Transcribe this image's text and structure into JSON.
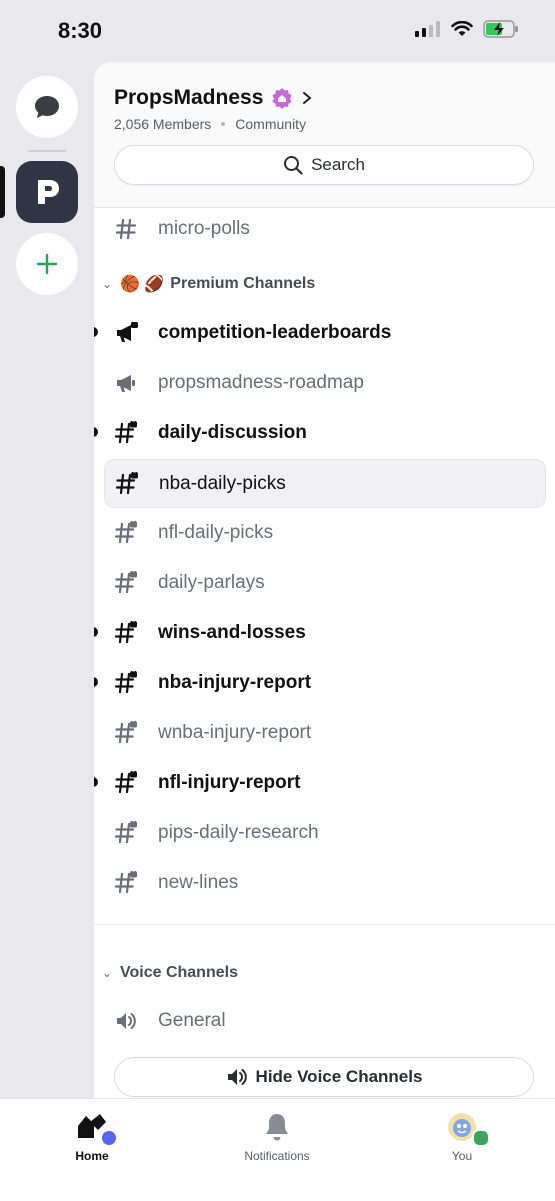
{
  "status": {
    "time": "8:30"
  },
  "server": {
    "name": "PropsMadness",
    "members": "2,056 Members",
    "type": "Community"
  },
  "search": {
    "label": "Search"
  },
  "top_channel": {
    "name": "micro-polls"
  },
  "premium_category": {
    "emoji": "🏀 🏈",
    "label": "Premium Channels"
  },
  "channels": [
    {
      "name": "competition-leaderboards",
      "icon": "megaphone-locked-icon",
      "unread": true
    },
    {
      "name": "propsmadness-roadmap",
      "icon": "megaphone-icon",
      "unread": false
    },
    {
      "name": "daily-discussion",
      "icon": "hash-locked-icon",
      "unread": true
    },
    {
      "name": "nba-daily-picks",
      "icon": "hash-locked-icon",
      "unread": false,
      "selected": true
    },
    {
      "name": "nfl-daily-picks",
      "icon": "hash-locked-icon",
      "unread": false
    },
    {
      "name": "daily-parlays",
      "icon": "hash-locked-icon",
      "unread": false
    },
    {
      "name": "wins-and-losses",
      "icon": "hash-locked-icon",
      "unread": true
    },
    {
      "name": "nba-injury-report",
      "icon": "hash-locked-icon",
      "unread": true
    },
    {
      "name": "wnba-injury-report",
      "icon": "hash-locked-icon",
      "unread": false
    },
    {
      "name": "nfl-injury-report",
      "icon": "hash-locked-icon",
      "unread": true
    },
    {
      "name": "pips-daily-research",
      "icon": "hash-locked-icon",
      "unread": false
    },
    {
      "name": "new-lines",
      "icon": "hash-locked-icon",
      "unread": false
    }
  ],
  "voice_category": {
    "label": "Voice Channels"
  },
  "voice_channels": [
    {
      "name": "General",
      "icon": "speaker-icon"
    }
  ],
  "hide_voice": {
    "label": "Hide Voice Channels"
  },
  "tabs": [
    {
      "label": "Home",
      "icon": "home-icon"
    },
    {
      "label": "Notifications",
      "icon": "bell-icon"
    },
    {
      "label": "You",
      "icon": "avatar-icon"
    }
  ],
  "colors": {
    "accent": "#5865f2",
    "online": "#3ba55d",
    "add": "#23a55a",
    "badge": "#c46ad6"
  }
}
